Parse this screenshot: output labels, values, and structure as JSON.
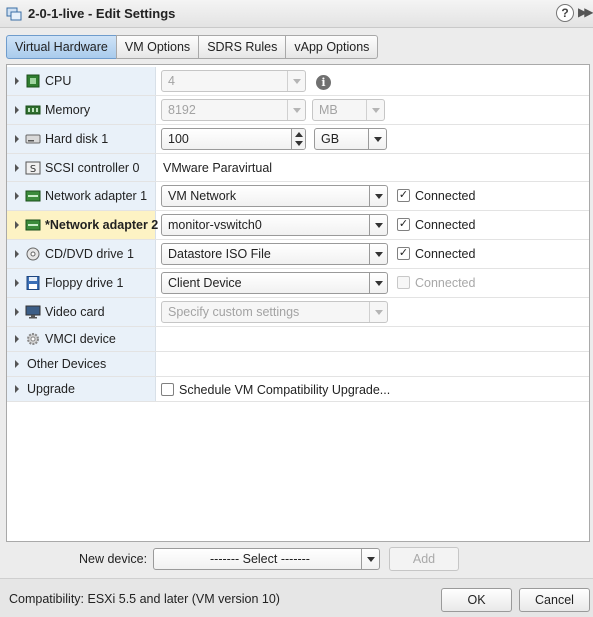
{
  "window": {
    "title": "2-0-1-live - Edit Settings",
    "help": "?"
  },
  "tabs": [
    {
      "label": "Virtual Hardware",
      "active": true
    },
    {
      "label": "VM Options"
    },
    {
      "label": "SDRS Rules"
    },
    {
      "label": "vApp Options"
    }
  ],
  "hardware": {
    "cpu": {
      "label": "CPU",
      "value": "4"
    },
    "memory": {
      "label": "Memory",
      "value": "8192",
      "unit": "MB"
    },
    "hard_disk": {
      "label": "Hard disk 1",
      "value": "100",
      "unit": "GB"
    },
    "scsi": {
      "label": "SCSI controller 0",
      "value": "VMware Paravirtual"
    },
    "net1": {
      "label": "Network adapter 1",
      "value": "VM Network",
      "connected_label": "Connected",
      "connected": true
    },
    "net2": {
      "label": "*Network adapter 2",
      "value": "monitor-vswitch0",
      "connected_label": "Connected",
      "connected": true
    },
    "cdrom": {
      "label": "CD/DVD drive 1",
      "value": "Datastore ISO File",
      "connected_label": "Connected",
      "connected": true
    },
    "floppy": {
      "label": "Floppy drive 1",
      "value": "Client Device",
      "connected_label": "Connected",
      "connected": false
    },
    "video": {
      "label": "Video card",
      "value": "Specify custom settings"
    },
    "vmci": {
      "label": "VMCI device"
    },
    "other": {
      "label": "Other Devices"
    },
    "upgrade": {
      "label": "Upgrade",
      "option_label": "Schedule VM Compatibility Upgrade..."
    }
  },
  "new_device": {
    "label": "New device:",
    "select_value": "------- Select -------",
    "add_label": "Add"
  },
  "footer": {
    "compatibility": "Compatibility: ESXi 5.5 and later (VM version 10)",
    "ok_label": "OK",
    "cancel_label": "Cancel"
  },
  "colors": {
    "active_tab": "#a9cbec",
    "label_column": "#e9f1f9",
    "highlight_row": "#fdf3c4"
  }
}
